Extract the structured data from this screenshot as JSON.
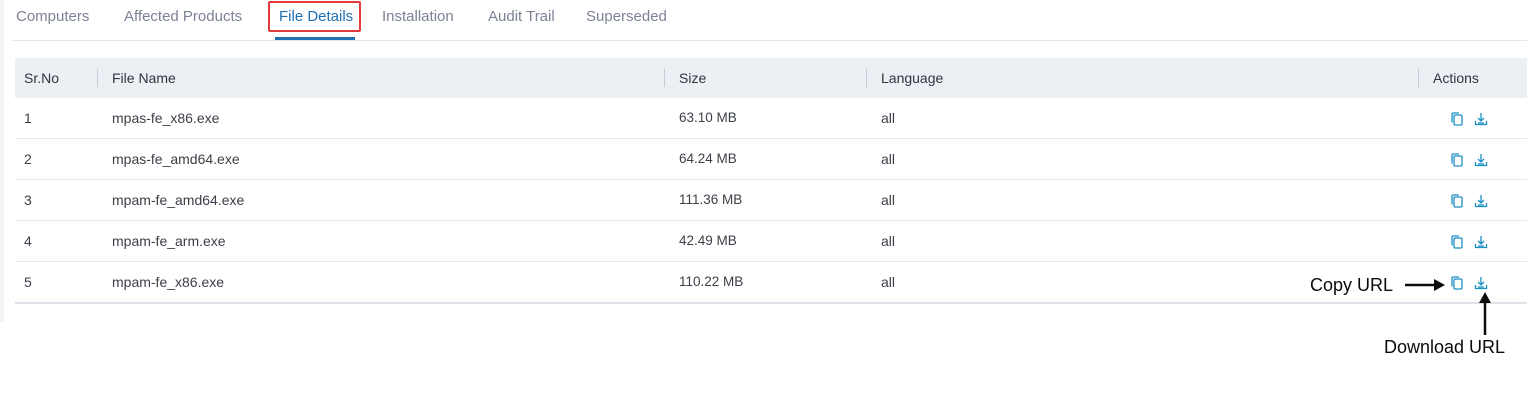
{
  "tabs": [
    {
      "label": "Computers"
    },
    {
      "label": "Affected Products"
    },
    {
      "label": "File Details"
    },
    {
      "label": "Installation"
    },
    {
      "label": "Audit Trail"
    },
    {
      "label": "Superseded"
    }
  ],
  "active_tab": "File Details",
  "table": {
    "headers": {
      "sr_no": "Sr.No",
      "file_name": "File Name",
      "size": "Size",
      "language": "Language",
      "actions": "Actions"
    },
    "rows": [
      {
        "sr_no": "1",
        "file_name": "mpas-fe_x86.exe",
        "size": "63.10 MB",
        "language": "all"
      },
      {
        "sr_no": "2",
        "file_name": "mpas-fe_amd64.exe",
        "size": "64.24 MB",
        "language": "all"
      },
      {
        "sr_no": "3",
        "file_name": "mpam-fe_amd64.exe",
        "size": "111.36 MB",
        "language": "all"
      },
      {
        "sr_no": "4",
        "file_name": "mpam-fe_arm.exe",
        "size": "42.49 MB",
        "language": "all"
      },
      {
        "sr_no": "5",
        "file_name": "mpam-fe_x86.exe",
        "size": "110.22 MB",
        "language": "all"
      }
    ]
  },
  "annotations": {
    "copy_url": "Copy URL",
    "download_url": "Download URL"
  },
  "icons": {
    "copy": "copy-icon",
    "download": "download-icon"
  },
  "colors": {
    "accent": "#1f6fb3",
    "icon": "#1a8fc4",
    "highlight": "#e23b3b"
  }
}
